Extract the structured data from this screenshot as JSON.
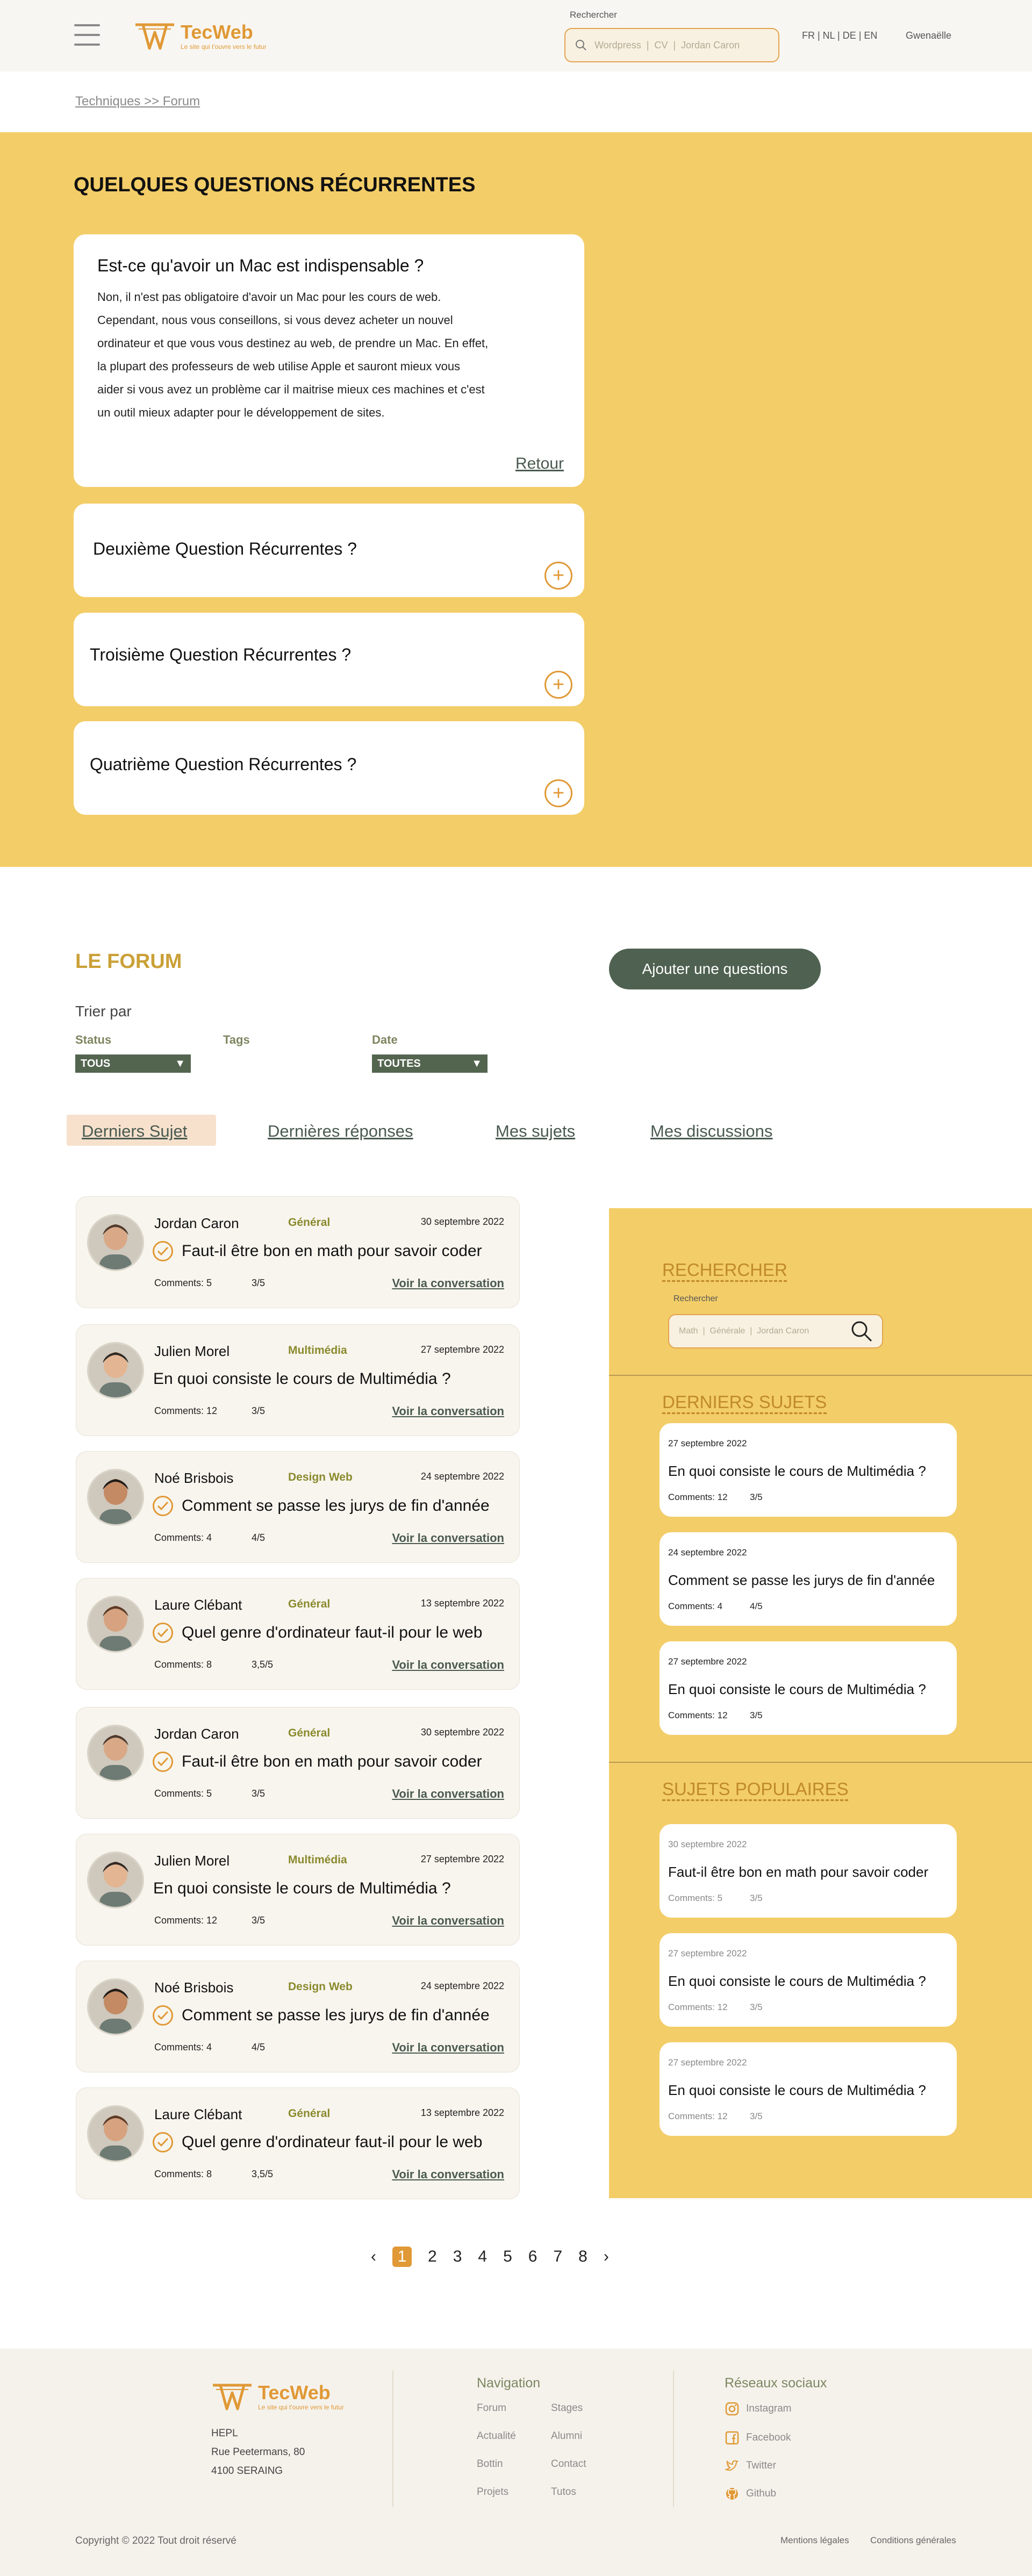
{
  "header": {
    "logo_name": "TecWeb",
    "logo_tagline": "Le site qui t'ouvre vers le futur",
    "search_label": "Rechercher",
    "search_placeholder": "Wordpress  |  CV  |  Jordan Caron",
    "langs": "FR | NL | DE | EN",
    "user": "Gwenaëlle"
  },
  "breadcrumb": "Techniques >> Forum",
  "faq": {
    "title": "QUELQUES QUESTIONS RÉCURRENTES",
    "open_question": "Est-ce qu'avoir un Mac est indispensable ?",
    "open_answer": "Non, il n'est pas obligatoire d'avoir un Mac pour les cours de web. Cependant, nous vous conseillons, si vous devez acheter un nouvel ordinateur et que vous vous destinez au web, de prendre un Mac. En effet, la plupart des professeurs de web utilise Apple et sauront mieux vous aider si vous avez un problème car il maitrise mieux ces machines et c'est un outil mieux adapter pour le développement de sites.",
    "back_label": "Retour",
    "questions": [
      "Deuxième Question Récurrentes ?",
      "Troisième Question Récurrentes ?",
      "Quatrième Question Récurrentes ?"
    ]
  },
  "forum": {
    "title": "LE FORUM",
    "add_button": "Ajouter une questions",
    "sort_label": "Trier par",
    "filters": {
      "status_label": "Status",
      "status_value": "TOUS",
      "tags_label": "Tags",
      "date_label": "Date",
      "date_value": "TOUTES"
    },
    "tabs": [
      "Derniers Sujet",
      "Dernières réponses",
      "Mes sujets",
      "Mes discussions"
    ],
    "topics": [
      {
        "author": "Jordan Caron",
        "category": "Général",
        "date": "30 septembre 2022",
        "title": "Faut-il être bon en math pour savoir coder",
        "resolved": true,
        "comments": "Comments: 5",
        "rating": "3/5",
        "link": "Voir la conversation"
      },
      {
        "author": "Julien Morel",
        "category": "Multimédia",
        "date": "27 septembre 2022",
        "title": "En quoi consiste le cours de Multimédia ?",
        "resolved": false,
        "comments": "Comments: 12",
        "rating": "3/5",
        "link": "Voir la conversation"
      },
      {
        "author": "Noé Brisbois",
        "category": "Design Web",
        "date": "24 septembre 2022",
        "title": "Comment se passe les jurys de fin d'année",
        "resolved": true,
        "comments": "Comments: 4",
        "rating": "4/5",
        "link": "Voir la conversation"
      },
      {
        "author": "Laure Clébant",
        "category": "Général",
        "date": "13 septembre 2022",
        "title": "Quel genre d'ordinateur faut-il pour le web",
        "resolved": true,
        "comments": "Comments: 8",
        "rating": "3,5/5",
        "link": "Voir la conversation"
      },
      {
        "author": "Jordan Caron",
        "category": "Général",
        "date": "30 septembre 2022",
        "title": "Faut-il être bon en math pour savoir coder",
        "resolved": true,
        "comments": "Comments: 5",
        "rating": "3/5",
        "link": "Voir la conversation"
      },
      {
        "author": "Julien Morel",
        "category": "Multimédia",
        "date": "27 septembre 2022",
        "title": "En quoi consiste le cours de Multimédia ?",
        "resolved": false,
        "comments": "Comments: 12",
        "rating": "3/5",
        "link": "Voir la conversation"
      },
      {
        "author": "Noé Brisbois",
        "category": "Design Web",
        "date": "24 septembre 2022",
        "title": "Comment se passe les jurys de fin d'année",
        "resolved": true,
        "comments": "Comments: 4",
        "rating": "4/5",
        "link": "Voir la conversation"
      },
      {
        "author": "Laure Clébant",
        "category": "Général",
        "date": "13 septembre 2022",
        "title": "Quel genre d'ordinateur faut-il pour le web",
        "resolved": true,
        "comments": "Comments: 8",
        "rating": "3,5/5",
        "link": "Voir la conversation"
      }
    ]
  },
  "sidebar": {
    "search_title": "RECHERCHER",
    "search_label": "Rechercher",
    "search_placeholder": "Math  |  Générale  |  Jordan Caron",
    "latest_title": "DERNIERS SUJETS",
    "latest": [
      {
        "date": "27 septembre 2022",
        "title": "En quoi consiste le cours de Multimédia ?",
        "comments": "Comments: 12",
        "rating": "3/5"
      },
      {
        "date": "24 septembre 2022",
        "title": "Comment se passe les jurys de fin d'année",
        "comments": "Comments: 4",
        "rating": "4/5"
      },
      {
        "date": "27 septembre 2022",
        "title": "En quoi consiste le cours de Multimédia ?",
        "comments": "Comments: 12",
        "rating": "3/5"
      }
    ],
    "popular_title": "SUJETS POPULAIRES",
    "popular": [
      {
        "date": "30 septembre 2022",
        "title": "Faut-il être bon en math pour savoir coder",
        "comments": "Comments: 5",
        "rating": "3/5"
      },
      {
        "date": "27 septembre 2022",
        "title": "En quoi consiste le cours de Multimédia ?",
        "comments": "Comments: 12",
        "rating": "3/5"
      },
      {
        "date": "27 septembre 2022",
        "title": "En quoi consiste le cours de Multimédia ?",
        "comments": "Comments: 12",
        "rating": "3/5"
      }
    ]
  },
  "pagination": {
    "prev": "‹",
    "pages": [
      "1",
      "2",
      "3",
      "4",
      "5",
      "6",
      "7",
      "8"
    ],
    "current": "1",
    "next": "›"
  },
  "footer": {
    "logo_name": "TecWeb",
    "logo_tagline": "Le site qui t'ouvre vers le futur",
    "address": [
      "HEPL",
      "Rue Peetermans, 80",
      "4100 SERAING"
    ],
    "nav_title": "Navigation",
    "nav_col1": [
      "Forum",
      "Actualité",
      "Bottin",
      "Projets"
    ],
    "nav_col2": [
      "Stages",
      "Alumni",
      "Contact",
      "Tutos"
    ],
    "social_title": "Réseaux sociaux",
    "social": [
      {
        "icon": "instagram-icon",
        "label": "Instagram"
      },
      {
        "icon": "facebook-icon",
        "label": "Facebook"
      },
      {
        "icon": "twitter-icon",
        "label": "Twitter"
      },
      {
        "icon": "github-icon",
        "label": "Github"
      }
    ],
    "copyright": "Copyright © 2022 Tout droit réservé",
    "legal": [
      "Mentions légales",
      "Conditions générales"
    ]
  },
  "colors": {
    "yellow": "#f3cd68",
    "orange": "#e09936",
    "green": "#4f6150",
    "olive": "#7d8660"
  }
}
